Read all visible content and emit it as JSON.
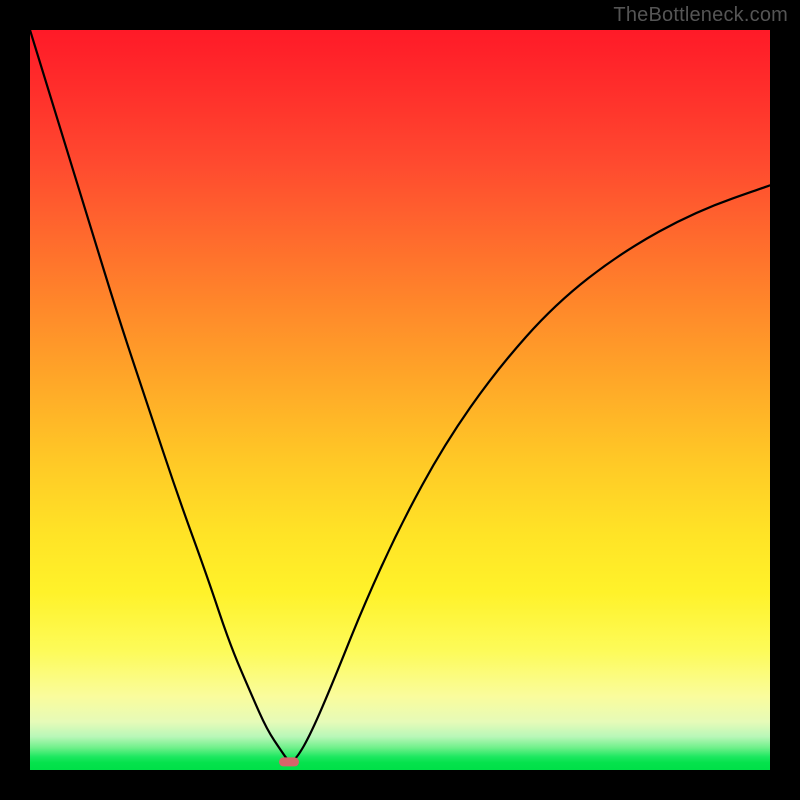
{
  "watermark": "TheBottleneck.com",
  "chart_data": {
    "type": "line",
    "title": "",
    "xlabel": "",
    "ylabel": "",
    "xlim": [
      0,
      100
    ],
    "ylim": [
      0,
      100
    ],
    "grid": false,
    "legend": false,
    "background": "rainbow-vertical-red-to-green",
    "series": [
      {
        "name": "bottleneck-curve",
        "x": [
          0,
          4,
          8,
          12,
          16,
          20,
          24,
          27,
          30,
          32,
          34,
          35,
          36,
          38,
          41,
          45,
          50,
          56,
          63,
          71,
          80,
          90,
          100
        ],
        "y": [
          100,
          87,
          74,
          61,
          49,
          37,
          26,
          17,
          10,
          5.5,
          2.5,
          1.1,
          1.5,
          5,
          12,
          22,
          33,
          44,
          54,
          63,
          70,
          75.5,
          79
        ]
      }
    ],
    "annotations": [
      {
        "name": "min-marker",
        "x": 35,
        "y": 1.1,
        "shape": "rounded-rect",
        "color": "#d6656a"
      }
    ]
  }
}
